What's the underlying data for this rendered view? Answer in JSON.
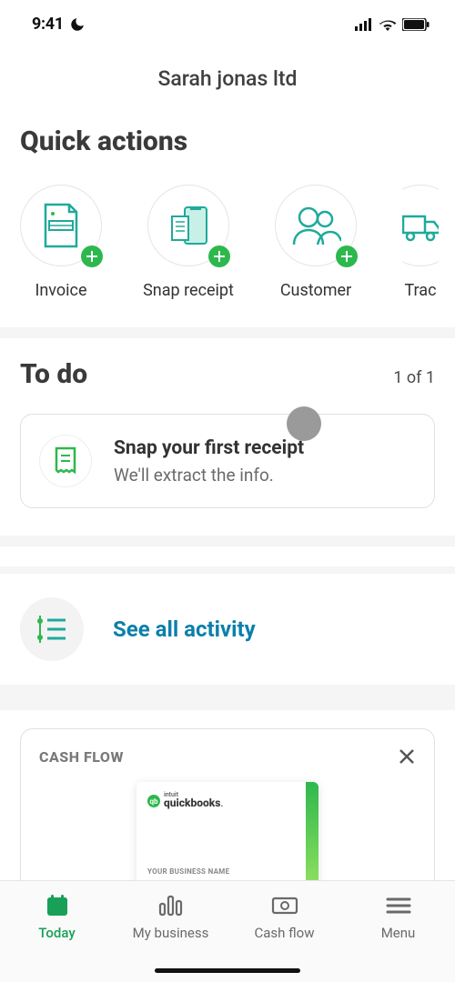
{
  "status": {
    "time": "9:41"
  },
  "header": {
    "title": "Sarah jonas ltd"
  },
  "quick_actions": {
    "title": "Quick actions",
    "items": [
      {
        "label": "Invoice",
        "icon": "invoice"
      },
      {
        "label": "Snap receipt",
        "icon": "snap-receipt"
      },
      {
        "label": "Customer",
        "icon": "customer"
      },
      {
        "label": "Trac",
        "icon": "track"
      }
    ]
  },
  "todo": {
    "title": "To do",
    "counter": "1 of 1",
    "card": {
      "title": "Snap your first receipt",
      "subtitle": "We'll extract the info."
    }
  },
  "activity": {
    "link": "See all activity"
  },
  "cashflow": {
    "title": "CASH FLOW",
    "card": {
      "brand_small": "intuit",
      "brand": "quickbooks",
      "placeholder": "YOUR BUSINESS NAME"
    }
  },
  "nav": {
    "items": [
      {
        "label": "Today"
      },
      {
        "label": "My business"
      },
      {
        "label": "Cash flow"
      },
      {
        "label": "Menu"
      }
    ]
  },
  "colors": {
    "accent_green": "#2db84d",
    "teal": "#1faa9b",
    "blue": "#0c7faa"
  }
}
